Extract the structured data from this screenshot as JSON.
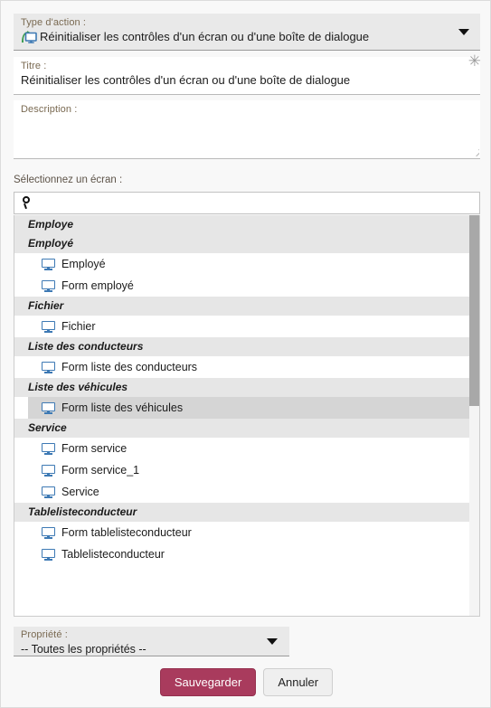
{
  "action_type": {
    "label": "Type d'action :",
    "value": "Réinitialiser les contrôles d'un écran ou d'une boîte de dialogue",
    "icon": "reset-screen-icon",
    "caret_icon": "chevron-down-icon"
  },
  "title": {
    "label": "Titre :",
    "value": "Réinitialiser les contrôles d'un écran ou d'une boîte de dialogue",
    "required_marker": "✳"
  },
  "description": {
    "label": "Description :",
    "value": ""
  },
  "screen_picker": {
    "label": "Sélectionnez un écran :",
    "search": {
      "placeholder": "",
      "value": "",
      "icon": "search-icon"
    },
    "groups": [
      {
        "header": "Employe",
        "items": []
      },
      {
        "header": "Employé",
        "items": [
          {
            "label": "Employé",
            "icon": "monitor-icon",
            "selected": false
          },
          {
            "label": "Form employé",
            "icon": "monitor-icon",
            "selected": false
          }
        ]
      },
      {
        "header": "Fichier",
        "items": [
          {
            "label": "Fichier",
            "icon": "monitor-icon",
            "selected": false
          }
        ]
      },
      {
        "header": "Liste des conducteurs",
        "items": [
          {
            "label": "Form liste des conducteurs",
            "icon": "monitor-icon",
            "selected": false
          }
        ]
      },
      {
        "header": "Liste des véhicules",
        "items": [
          {
            "label": "Form liste des véhicules",
            "icon": "monitor-icon",
            "selected": true
          }
        ]
      },
      {
        "header": "Service",
        "items": [
          {
            "label": "Form service",
            "icon": "monitor-icon",
            "selected": false
          },
          {
            "label": "Form service_1",
            "icon": "monitor-icon",
            "selected": false
          },
          {
            "label": "Service",
            "icon": "monitor-icon",
            "selected": false
          }
        ]
      },
      {
        "header": "Tablelisteconducteur",
        "items": [
          {
            "label": "Form tablelisteconducteur",
            "icon": "monitor-icon",
            "selected": false
          },
          {
            "label": "Tablelisteconducteur",
            "icon": "monitor-icon",
            "selected": false
          }
        ]
      }
    ]
  },
  "property": {
    "label": "Propriété :",
    "value": "-- Toutes les propriétés --",
    "caret_icon": "chevron-down-icon"
  },
  "buttons": {
    "save_label": "Sauvegarder",
    "cancel_label": "Annuler"
  },
  "colors": {
    "accent": "#a93b5d",
    "label_text": "#7a6a52",
    "icon_blue": "#3d79b4",
    "icon_green": "#3a9b4e",
    "group_header_bg": "#e6e6e6",
    "selected_bg": "#d5d5d5"
  }
}
